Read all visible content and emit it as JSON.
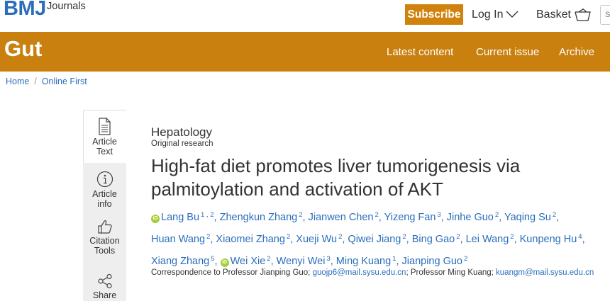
{
  "header": {
    "brand": "BMJ",
    "brand_suffix": "Journals",
    "subscribe_label": "Subscribe",
    "login_label": "Log In",
    "basket_label": "Basket",
    "search_placeholder": "S"
  },
  "journal": {
    "name": "Gut",
    "nav": [
      "Latest content",
      "Current issue",
      "Archive"
    ]
  },
  "breadcrumb": [
    "Home",
    "Online First"
  ],
  "tabs": [
    {
      "label": "Article\nText",
      "icon": "document-icon",
      "active": true
    },
    {
      "label": "Article\ninfo",
      "icon": "info-icon",
      "active": false
    },
    {
      "label": "Citation\nTools",
      "icon": "thumbs-up-icon",
      "active": false
    },
    {
      "label": "Share",
      "icon": "share-icon",
      "active": false
    }
  ],
  "article": {
    "section": "Hepatology",
    "type": "Original research",
    "title": "High-fat diet promotes liver tumorigenesis via palmitoylation and activation of AKT",
    "authors": [
      {
        "name": "Lang Bu",
        "aff": "1 , 2",
        "orcid": true
      },
      {
        "name": "Zhengkun Zhang",
        "aff": "2",
        "orcid": false
      },
      {
        "name": "Jianwen Chen",
        "aff": "2",
        "orcid": false
      },
      {
        "name": "Yizeng Fan",
        "aff": "3",
        "orcid": false
      },
      {
        "name": "Jinhe Guo",
        "aff": "2",
        "orcid": false
      },
      {
        "name": "Yaqing Su",
        "aff": "2",
        "orcid": false
      },
      {
        "name": "Huan Wang",
        "aff": "2",
        "orcid": false
      },
      {
        "name": "Xiaomei Zhang",
        "aff": "2",
        "orcid": false
      },
      {
        "name": "Xueji Wu",
        "aff": "2",
        "orcid": false
      },
      {
        "name": "Qiwei Jiang",
        "aff": "2",
        "orcid": false
      },
      {
        "name": "Bing Gao",
        "aff": "2",
        "orcid": false
      },
      {
        "name": "Lei Wang",
        "aff": "2",
        "orcid": false
      },
      {
        "name": "Kunpeng Hu",
        "aff": "4",
        "orcid": false
      },
      {
        "name": "Xiang Zhang",
        "aff": "5",
        "orcid": false
      },
      {
        "name": "Wei Xie",
        "aff": "2",
        "orcid": true
      },
      {
        "name": "Wenyi Wei",
        "aff": "3",
        "orcid": false
      },
      {
        "name": "Ming Kuang",
        "aff": "1",
        "orcid": false
      },
      {
        "name": "Jianping Guo",
        "aff": "2",
        "orcid": false
      }
    ],
    "correspondence": {
      "prefix": "Correspondence to Professor Jianping Guo;",
      "email1": "guojp6@mail.sysu.edu.cn",
      "middle": "; Professor Ming Kuang;",
      "email2": "kuangm@mail.sysu.edu.cn"
    }
  },
  "colors": {
    "brand_blue": "#2a6ebb",
    "journal_orange": "#c9800f",
    "subscribe_orange": "#d0820d",
    "orcid_green": "#a6ce39"
  }
}
